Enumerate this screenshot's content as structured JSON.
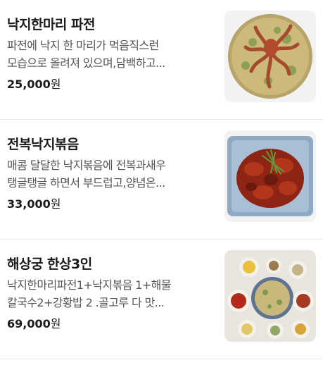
{
  "menu": [
    {
      "name": "낙지한마리 파전",
      "desc_line1": "파전에 낙지 한 마리가 먹음직스런",
      "desc_line2": "모습으로 올려져 있으며,담백하고...",
      "price": "25,000",
      "unit": "원",
      "image": "seafood-pancake-with-whole-octopus"
    },
    {
      "name": "전복낙지볶음",
      "desc_line1": "매콤 달달한 낙지볶음에 전복과새우",
      "desc_line2": "탱글탱글 하면서 부드럽고,양념은...",
      "price": "33,000",
      "unit": "원",
      "image": "stir-fried-octopus-with-abalone"
    },
    {
      "name": "해상궁 한상3인",
      "desc_line1": "낙지한마리파전1+낙지볶음 1+해물",
      "desc_line2": "칼국수2+강황밥 2 .골고루 다 맛...",
      "price": "69,000",
      "unit": "원",
      "image": "three-person-set-meal-table"
    }
  ]
}
